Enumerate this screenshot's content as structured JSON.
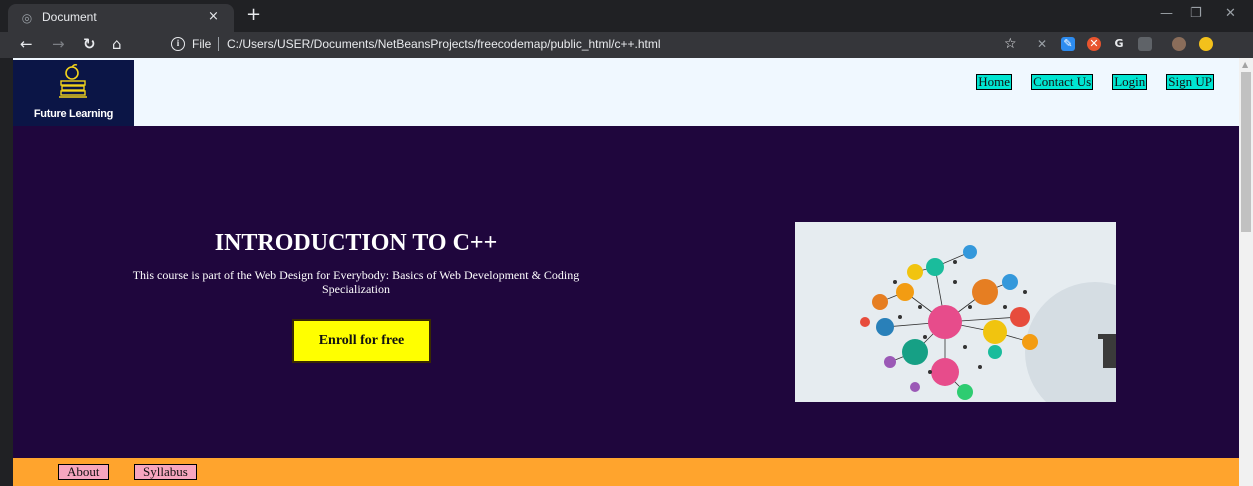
{
  "browser": {
    "tab_title": "Document",
    "tab_close": "×",
    "new_tab": "+",
    "address_prefix": "File",
    "url": "C:/Users/USER/Documents/NetBeansProjects/freecodemap/public_html/c++.html",
    "minimize": "—",
    "restore": "❐",
    "close": "✕"
  },
  "site": {
    "logo_text": "Future Learning",
    "nav": [
      "Home",
      "Contact Us",
      "Login",
      "Sign UP"
    ]
  },
  "hero": {
    "title": "INTRODUCTION TO C++",
    "subtitle": "This course is part of the Web Design for Everybody: Basics of Web Development & Coding Specialization",
    "enroll_label": "Enroll for free"
  },
  "section_tabs": [
    "About",
    "Syllabus"
  ],
  "colors": {
    "header_bg": "#f0f8ff",
    "hero_bg": "#1f063d",
    "nav_link_bg": "#00e5d1",
    "enroll_bg": "#ffff00",
    "tabs_bar_bg": "#ffa42d",
    "tab_bg": "#f7a6bf"
  }
}
